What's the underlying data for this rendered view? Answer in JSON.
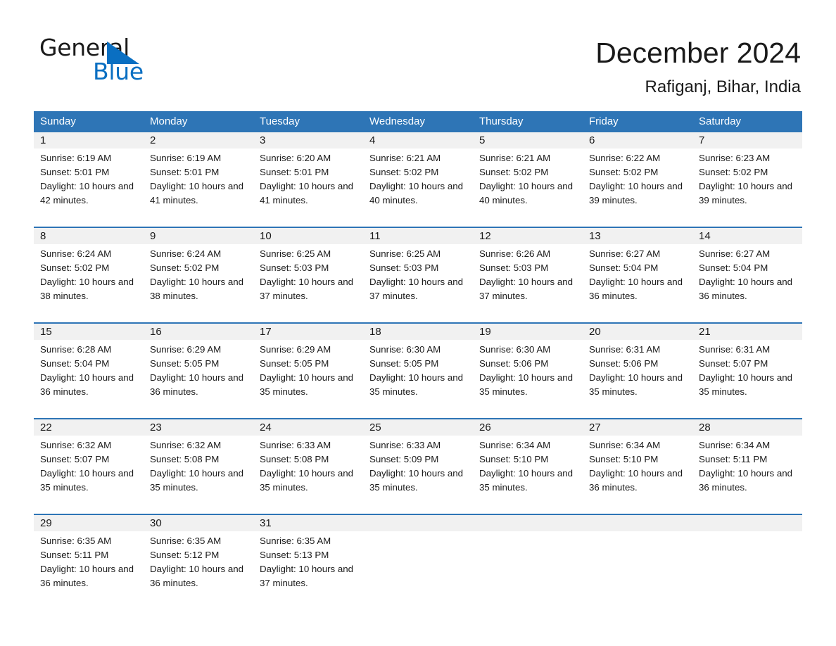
{
  "brand": {
    "name_part1": "General",
    "name_part2": "Blue",
    "accent_color": "#0a6fc2"
  },
  "header": {
    "month_title": "December 2024",
    "location": "Rafiganj, Bihar, India"
  },
  "calendar": {
    "header_color": "#2e75b6",
    "daynum_band_color": "#f1f1f1",
    "weekdays": [
      "Sunday",
      "Monday",
      "Tuesday",
      "Wednesday",
      "Thursday",
      "Friday",
      "Saturday"
    ],
    "weeks": [
      [
        {
          "day": "1",
          "sunrise": "Sunrise: 6:19 AM",
          "sunset": "Sunset: 5:01 PM",
          "daylight": "Daylight: 10 hours and 42 minutes."
        },
        {
          "day": "2",
          "sunrise": "Sunrise: 6:19 AM",
          "sunset": "Sunset: 5:01 PM",
          "daylight": "Daylight: 10 hours and 41 minutes."
        },
        {
          "day": "3",
          "sunrise": "Sunrise: 6:20 AM",
          "sunset": "Sunset: 5:01 PM",
          "daylight": "Daylight: 10 hours and 41 minutes."
        },
        {
          "day": "4",
          "sunrise": "Sunrise: 6:21 AM",
          "sunset": "Sunset: 5:02 PM",
          "daylight": "Daylight: 10 hours and 40 minutes."
        },
        {
          "day": "5",
          "sunrise": "Sunrise: 6:21 AM",
          "sunset": "Sunset: 5:02 PM",
          "daylight": "Daylight: 10 hours and 40 minutes."
        },
        {
          "day": "6",
          "sunrise": "Sunrise: 6:22 AM",
          "sunset": "Sunset: 5:02 PM",
          "daylight": "Daylight: 10 hours and 39 minutes."
        },
        {
          "day": "7",
          "sunrise": "Sunrise: 6:23 AM",
          "sunset": "Sunset: 5:02 PM",
          "daylight": "Daylight: 10 hours and 39 minutes."
        }
      ],
      [
        {
          "day": "8",
          "sunrise": "Sunrise: 6:24 AM",
          "sunset": "Sunset: 5:02 PM",
          "daylight": "Daylight: 10 hours and 38 minutes."
        },
        {
          "day": "9",
          "sunrise": "Sunrise: 6:24 AM",
          "sunset": "Sunset: 5:02 PM",
          "daylight": "Daylight: 10 hours and 38 minutes."
        },
        {
          "day": "10",
          "sunrise": "Sunrise: 6:25 AM",
          "sunset": "Sunset: 5:03 PM",
          "daylight": "Daylight: 10 hours and 37 minutes."
        },
        {
          "day": "11",
          "sunrise": "Sunrise: 6:25 AM",
          "sunset": "Sunset: 5:03 PM",
          "daylight": "Daylight: 10 hours and 37 minutes."
        },
        {
          "day": "12",
          "sunrise": "Sunrise: 6:26 AM",
          "sunset": "Sunset: 5:03 PM",
          "daylight": "Daylight: 10 hours and 37 minutes."
        },
        {
          "day": "13",
          "sunrise": "Sunrise: 6:27 AM",
          "sunset": "Sunset: 5:04 PM",
          "daylight": "Daylight: 10 hours and 36 minutes."
        },
        {
          "day": "14",
          "sunrise": "Sunrise: 6:27 AM",
          "sunset": "Sunset: 5:04 PM",
          "daylight": "Daylight: 10 hours and 36 minutes."
        }
      ],
      [
        {
          "day": "15",
          "sunrise": "Sunrise: 6:28 AM",
          "sunset": "Sunset: 5:04 PM",
          "daylight": "Daylight: 10 hours and 36 minutes."
        },
        {
          "day": "16",
          "sunrise": "Sunrise: 6:29 AM",
          "sunset": "Sunset: 5:05 PM",
          "daylight": "Daylight: 10 hours and 36 minutes."
        },
        {
          "day": "17",
          "sunrise": "Sunrise: 6:29 AM",
          "sunset": "Sunset: 5:05 PM",
          "daylight": "Daylight: 10 hours and 35 minutes."
        },
        {
          "day": "18",
          "sunrise": "Sunrise: 6:30 AM",
          "sunset": "Sunset: 5:05 PM",
          "daylight": "Daylight: 10 hours and 35 minutes."
        },
        {
          "day": "19",
          "sunrise": "Sunrise: 6:30 AM",
          "sunset": "Sunset: 5:06 PM",
          "daylight": "Daylight: 10 hours and 35 minutes."
        },
        {
          "day": "20",
          "sunrise": "Sunrise: 6:31 AM",
          "sunset": "Sunset: 5:06 PM",
          "daylight": "Daylight: 10 hours and 35 minutes."
        },
        {
          "day": "21",
          "sunrise": "Sunrise: 6:31 AM",
          "sunset": "Sunset: 5:07 PM",
          "daylight": "Daylight: 10 hours and 35 minutes."
        }
      ],
      [
        {
          "day": "22",
          "sunrise": "Sunrise: 6:32 AM",
          "sunset": "Sunset: 5:07 PM",
          "daylight": "Daylight: 10 hours and 35 minutes."
        },
        {
          "day": "23",
          "sunrise": "Sunrise: 6:32 AM",
          "sunset": "Sunset: 5:08 PM",
          "daylight": "Daylight: 10 hours and 35 minutes."
        },
        {
          "day": "24",
          "sunrise": "Sunrise: 6:33 AM",
          "sunset": "Sunset: 5:08 PM",
          "daylight": "Daylight: 10 hours and 35 minutes."
        },
        {
          "day": "25",
          "sunrise": "Sunrise: 6:33 AM",
          "sunset": "Sunset: 5:09 PM",
          "daylight": "Daylight: 10 hours and 35 minutes."
        },
        {
          "day": "26",
          "sunrise": "Sunrise: 6:34 AM",
          "sunset": "Sunset: 5:10 PM",
          "daylight": "Daylight: 10 hours and 35 minutes."
        },
        {
          "day": "27",
          "sunrise": "Sunrise: 6:34 AM",
          "sunset": "Sunset: 5:10 PM",
          "daylight": "Daylight: 10 hours and 36 minutes."
        },
        {
          "day": "28",
          "sunrise": "Sunrise: 6:34 AM",
          "sunset": "Sunset: 5:11 PM",
          "daylight": "Daylight: 10 hours and 36 minutes."
        }
      ],
      [
        {
          "day": "29",
          "sunrise": "Sunrise: 6:35 AM",
          "sunset": "Sunset: 5:11 PM",
          "daylight": "Daylight: 10 hours and 36 minutes."
        },
        {
          "day": "30",
          "sunrise": "Sunrise: 6:35 AM",
          "sunset": "Sunset: 5:12 PM",
          "daylight": "Daylight: 10 hours and 36 minutes."
        },
        {
          "day": "31",
          "sunrise": "Sunrise: 6:35 AM",
          "sunset": "Sunset: 5:13 PM",
          "daylight": "Daylight: 10 hours and 37 minutes."
        },
        {
          "day": "",
          "sunrise": "",
          "sunset": "",
          "daylight": ""
        },
        {
          "day": "",
          "sunrise": "",
          "sunset": "",
          "daylight": ""
        },
        {
          "day": "",
          "sunrise": "",
          "sunset": "",
          "daylight": ""
        },
        {
          "day": "",
          "sunrise": "",
          "sunset": "",
          "daylight": ""
        }
      ]
    ]
  }
}
